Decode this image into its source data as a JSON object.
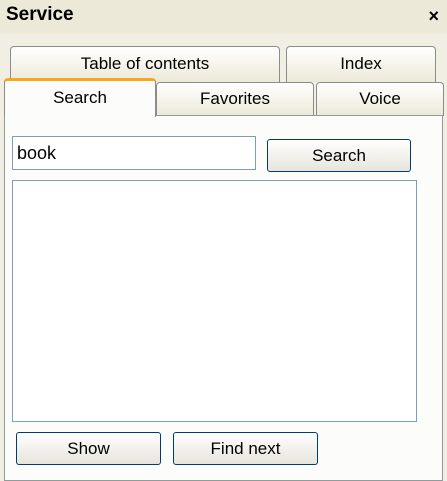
{
  "window": {
    "title": "Service",
    "close_glyph": "×"
  },
  "tabs_row1": [
    {
      "label": "Table of contents"
    },
    {
      "label": "Index"
    }
  ],
  "tabs_row2": [
    {
      "label": "Search",
      "active": true
    },
    {
      "label": "Favorites"
    },
    {
      "label": "Voice"
    }
  ],
  "search": {
    "value": "book",
    "button_label": "Search"
  },
  "results": {
    "items": []
  },
  "actions": {
    "show_label": "Show",
    "find_next_label": "Find next"
  }
}
